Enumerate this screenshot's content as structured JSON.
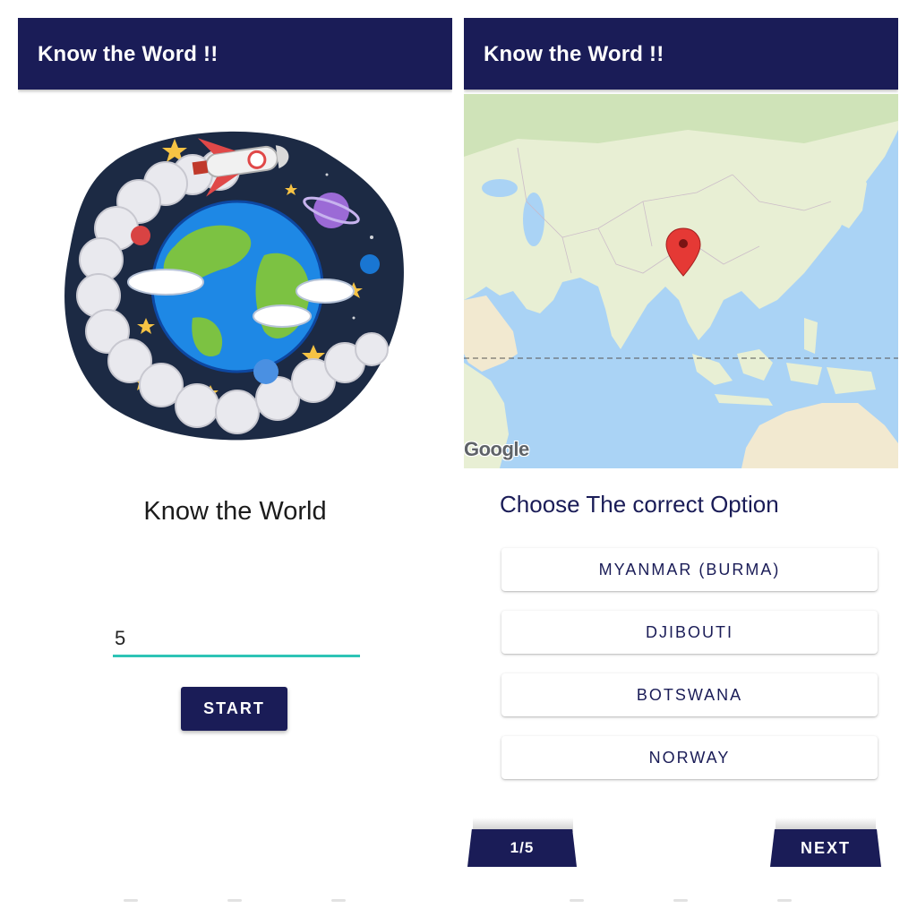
{
  "left_screen": {
    "appbar": {
      "title": "Know the Word !!"
    },
    "welcome_text": "Know the World",
    "question_count_input": {
      "value": "5"
    },
    "start_button": {
      "label": "START"
    }
  },
  "right_screen": {
    "appbar": {
      "title": "Know the Word !!"
    },
    "map": {
      "attribution": "Google",
      "marker_icon": "map-pin-icon"
    },
    "question": "Choose The correct Option",
    "options": [
      {
        "label": "MYANMAR (BURMA)"
      },
      {
        "label": "DJIBOUTI"
      },
      {
        "label": "BOTSWANA"
      },
      {
        "label": "NORWAY"
      }
    ],
    "progress": {
      "label": "1/5",
      "current": 1,
      "total": 5
    },
    "next_button": {
      "label": "NEXT"
    }
  },
  "colors": {
    "primary": "#1a1c57",
    "accent": "#2ec4b6",
    "map_water": "#aad3f5",
    "map_land": "#e8efd4",
    "marker": "#e53935"
  }
}
